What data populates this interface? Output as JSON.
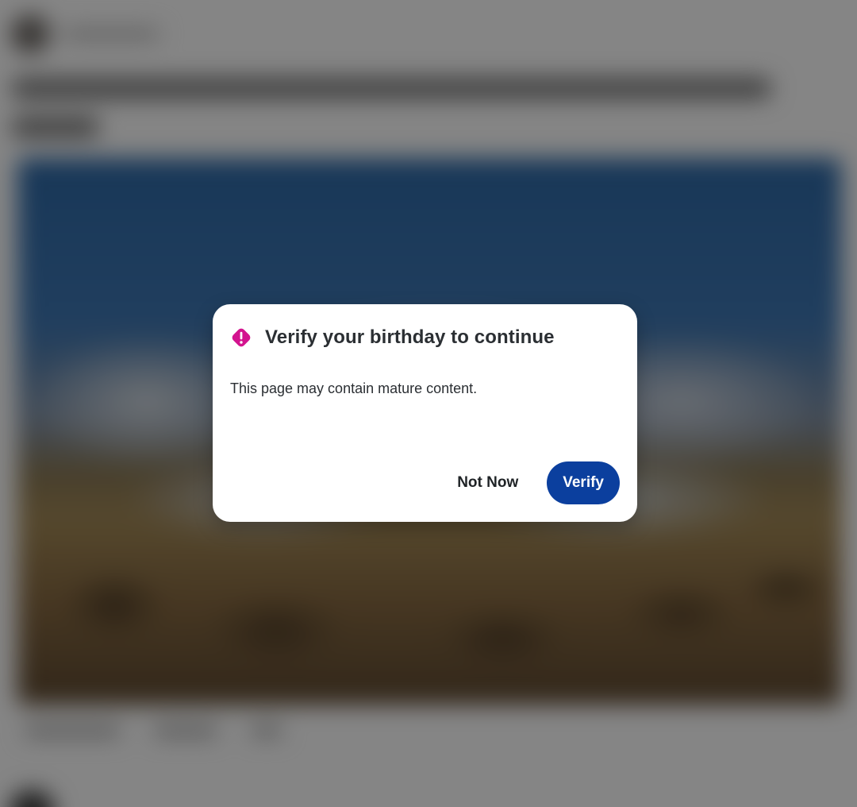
{
  "modal": {
    "title": "Verify your birthday to continue",
    "message": "This page may contain mature content.",
    "secondary_button": "Not Now",
    "primary_button": "Verify",
    "icon": "warning-diamond-icon"
  },
  "colors": {
    "accent_icon": "#d3148f",
    "primary_button": "#0b3f9e",
    "text": "#2b2f33",
    "scrim": "rgba(0,0,0,0.48)"
  }
}
